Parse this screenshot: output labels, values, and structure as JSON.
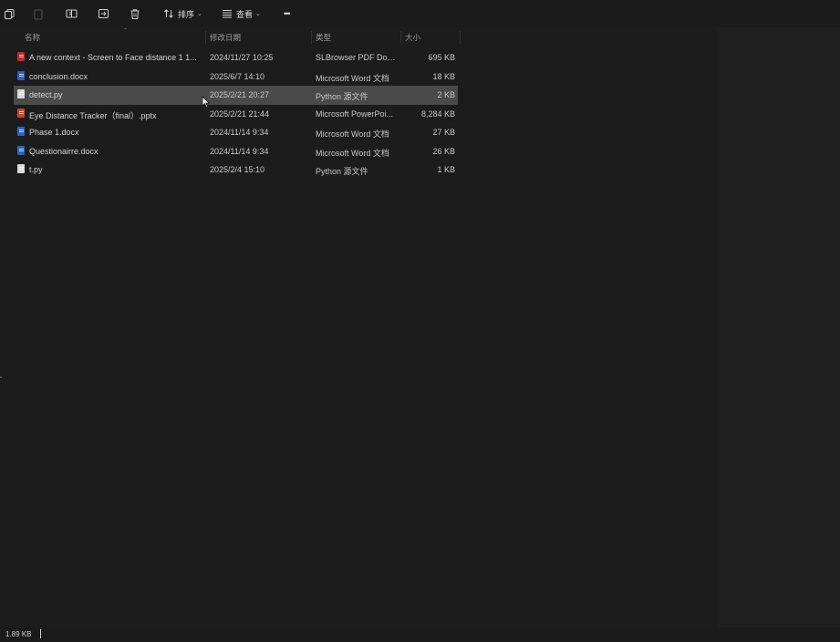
{
  "toolbar": {
    "sort_label": "排序",
    "view_label": "查看",
    "more_label": "•••",
    "caret": "⌄"
  },
  "columns": {
    "name": "名称",
    "date": "修改日期",
    "type": "类型",
    "size": "大小"
  },
  "files": [
    {
      "name": "A new context - Screen to Face distance 1 1...",
      "date": "2024/11/27 10:25",
      "type": "SLBrowser PDF Doc...",
      "size": "695 KB",
      "icon": "pdf-file-icon",
      "icon_color": "#c4262e"
    },
    {
      "name": "conclusion.docx",
      "date": "2025/6/7 14:10",
      "type": "Microsoft Word 文档",
      "size": "18 KB",
      "icon": "word-file-icon",
      "icon_color": "#2b63c6"
    },
    {
      "name": "detect.py",
      "date": "2025/2/21 20:27",
      "type": "Python 源文件",
      "size": "2 KB",
      "icon": "python-file-icon",
      "icon_color": "#d9d9d9",
      "selected": true
    },
    {
      "name": "Eye Distance Tracker（final）.pptx",
      "date": "2025/2/21 21:44",
      "type": "Microsoft PowerPoi...",
      "size": "8,284 KB",
      "icon": "powerpoint-file-icon",
      "icon_color": "#c8482b"
    },
    {
      "name": "Phase 1.docx",
      "date": "2024/11/14 9:34",
      "type": "Microsoft Word 文档",
      "size": "27 KB",
      "icon": "word-file-icon",
      "icon_color": "#2b63c6"
    },
    {
      "name": "Questionairre.docx",
      "date": "2024/11/14 9:34",
      "type": "Microsoft Word 文档",
      "size": "26 KB",
      "icon": "word-file-icon",
      "icon_color": "#2b63c6"
    },
    {
      "name": "t.py",
      "date": "2025/2/4 15:10",
      "type": "Python 源文件",
      "size": "1 KB",
      "icon": "python-file-icon",
      "icon_color": "#d9d9d9"
    }
  ],
  "status": {
    "selection_size": "1.89 KB"
  }
}
